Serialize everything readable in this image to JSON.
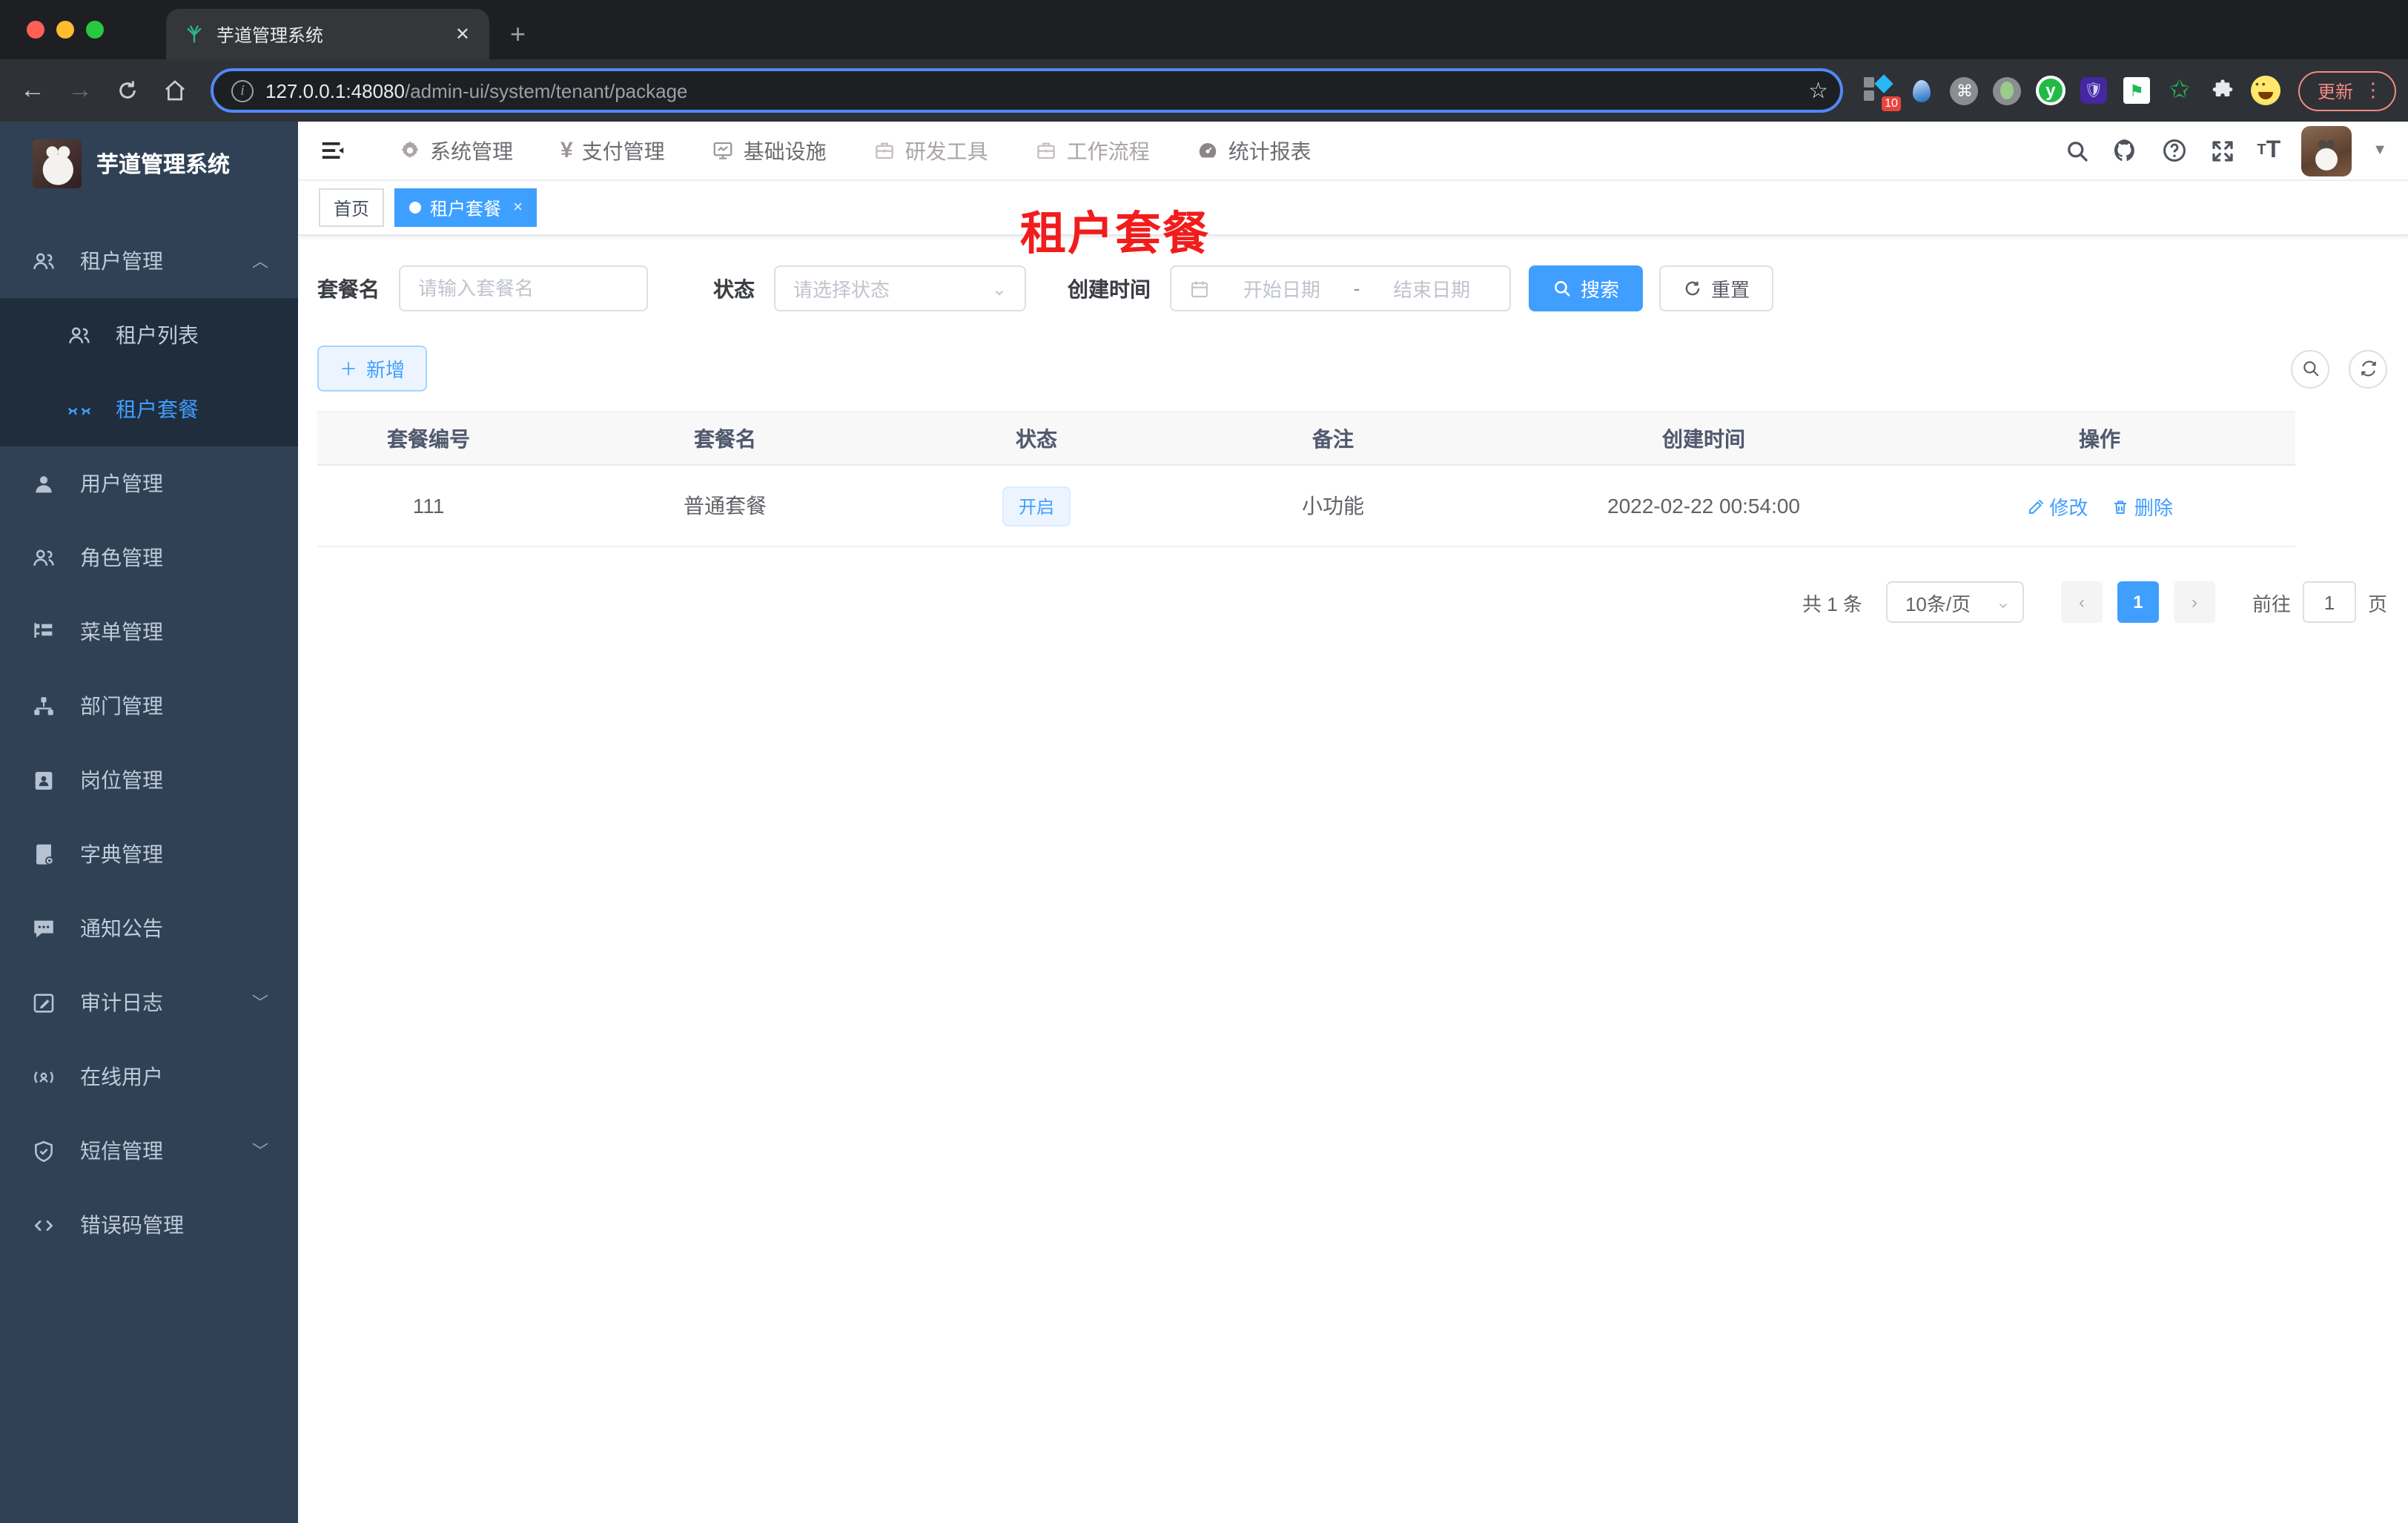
{
  "browser": {
    "tab_title": "芋道管理系统",
    "close_glyph": "✕",
    "newtab_glyph": "+",
    "back_glyph": "←",
    "forward_glyph": "→",
    "info_glyph": "i",
    "url_host": "127.0.0.1:48080",
    "url_path": "/admin-ui/system/tenant/package",
    "star_glyph": "☆",
    "ext_badge": "10",
    "cmd_glyph": "⌘",
    "flag_glyph": "⚑",
    "green_star_glyph": "✩",
    "puzzle_glyph": "🧩",
    "shield_glyph": "🛡",
    "y_glyph": "y",
    "update_label": "更新",
    "kebab_glyph": "⋮"
  },
  "sidebar": {
    "title": "芋道管理系统",
    "items": [
      {
        "label": "租户管理",
        "caret": "︿"
      },
      {
        "label": "租户列表"
      },
      {
        "label": "租户套餐"
      },
      {
        "label": "用户管理"
      },
      {
        "label": "角色管理"
      },
      {
        "label": "菜单管理"
      },
      {
        "label": "部门管理"
      },
      {
        "label": "岗位管理"
      },
      {
        "label": "字典管理"
      },
      {
        "label": "通知公告"
      },
      {
        "label": "审计日志",
        "caret": "﹀"
      },
      {
        "label": "在线用户"
      },
      {
        "label": "短信管理",
        "caret": "﹀"
      },
      {
        "label": "错误码管理"
      }
    ]
  },
  "topnav": {
    "yen_glyph": "¥",
    "items": [
      {
        "label": "系统管理"
      },
      {
        "label": "支付管理"
      },
      {
        "label": "基础设施"
      },
      {
        "label": "研发工具"
      },
      {
        "label": "工作流程"
      },
      {
        "label": "统计报表"
      }
    ]
  },
  "tags": {
    "home": "首页",
    "current": "租户套餐",
    "close_glyph": "×"
  },
  "page": {
    "overlay_title": "租户套餐"
  },
  "form": {
    "name_label": "套餐名",
    "name_placeholder": "请输入套餐名",
    "status_label": "状态",
    "status_placeholder": "请选择状态",
    "date_label": "创建时间",
    "date_start": "开始日期",
    "date_sep": "-",
    "date_end": "结束日期",
    "search_label": "搜索",
    "reset_label": "重置",
    "add_label": "新增",
    "plus_glyph": "＋"
  },
  "table": {
    "columns": [
      "套餐编号",
      "套餐名",
      "状态",
      "备注",
      "创建时间",
      "操作"
    ],
    "row": {
      "id": "111",
      "name": "普通套餐",
      "status": "开启",
      "remark": "小功能",
      "created": "2022-02-22 00:54:00",
      "edit": "修改",
      "delete": "删除"
    }
  },
  "pagination": {
    "total": "共 1 条",
    "per_page": "10条/页",
    "prev_glyph": "‹",
    "page": "1",
    "next_glyph": "›",
    "goto_label": "前往",
    "goto_value": "1",
    "unit": "页"
  },
  "colors": {
    "accent": "#409eff",
    "overlay_red": "#f21c1c",
    "sidebar_bg": "#304156",
    "submenu_bg": "#1f2d3d"
  }
}
